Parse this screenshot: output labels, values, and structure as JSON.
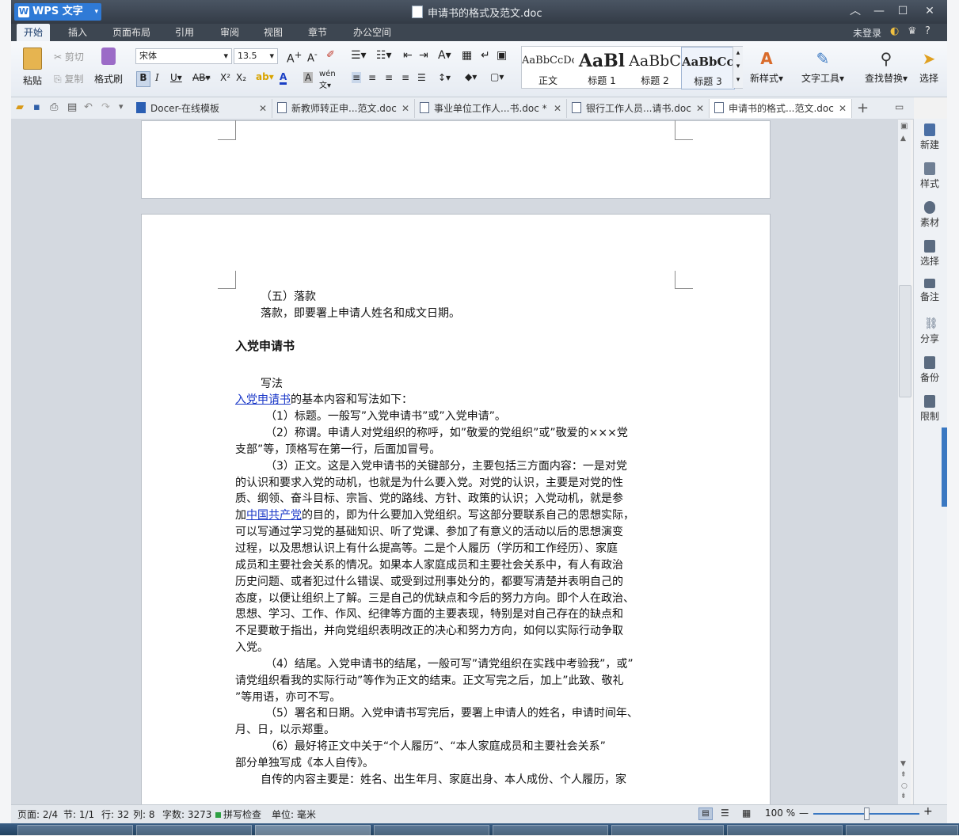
{
  "window": {
    "app_name": "WPS 文字",
    "doc_title": "申请书的格式及范文.doc"
  },
  "menu": {
    "tabs": [
      "开始",
      "插入",
      "页面布局",
      "引用",
      "审阅",
      "视图",
      "章节",
      "办公空间"
    ],
    "login": "未登录"
  },
  "ribbon": {
    "paste": "粘贴",
    "cut": "剪切",
    "copy": "复制",
    "format_painter": "格式刷",
    "font_name": "宋体",
    "font_size": "13.5",
    "styles": [
      {
        "preview": "AaBbCcDc",
        "name": "正文"
      },
      {
        "preview": "AaBl",
        "name": "标题 1"
      },
      {
        "preview": "AaBbC",
        "name": "标题 2"
      },
      {
        "preview": "AaBbCcI",
        "name": "标题 3"
      }
    ],
    "new_style": "新样式",
    "text_tools": "文字工具",
    "find_replace": "查找替换",
    "select": "选择"
  },
  "tabs": [
    {
      "label": "Docer-在线模板"
    },
    {
      "label": "新教师转正申...范文.doc"
    },
    {
      "label": "事业单位工作人...书.doc *"
    },
    {
      "label": "银行工作人员...请书.doc"
    },
    {
      "label": "申请书的格式...范文.doc"
    }
  ],
  "sidebar": {
    "items": [
      "新建",
      "样式",
      "素材",
      "选择",
      "备注",
      "分享",
      "备份",
      "限制"
    ]
  },
  "document": {
    "l1": "（五）落款",
    "l2": "落款，即要署上申请人姓名和成文日期。",
    "heading": "入党申请书",
    "l3": "写法",
    "l4_link": "入党申请书",
    "l4_rest": "的基本内容和写法如下：",
    "l5": "（1）标题。一般写”入党申请书”或”入党申请”。",
    "l6": "（2）称谓。申请人对党组织的称呼，如”敬爱的党组织”或”敬爱的×××党",
    "l7": "支部”等，顶格写在第一行，后面加冒号。",
    "l8": "（3）正文。这是入党申请书的关键部分，主要包括三方面内容：一是对党",
    "l9": "的认识和要求入党的动机，也就是为什么要入党。对党的认识，主要是对党的性",
    "l10": "质、纲领、奋斗目标、宗旨、党的路线、方针、政策的认识；入党动机，就是参",
    "l11_pre": "加",
    "l11_link": "中国共产党",
    "l11_rest": "的目的，即为什么要加入党组织。写这部分要联系自己的思想实际，",
    "l12": "可以写通过学习党的基础知识、听了党课、参加了有意义的活动以后的思想演变",
    "l13": "过程，以及思想认识上有什么提高等。二是个人履历（学历和工作经历）、家庭",
    "l14": "成员和主要社会关系的情况。如果本人家庭成员和主要社会关系中，有人有政治",
    "l15": "历史问题、或者犯过什么错误、或受到过刑事处分的，都要写清楚并表明自己的",
    "l16": "态度，以便让组织上了解。三是自己的优缺点和今后的努力方向。即个人在政治、",
    "l17": "思想、学习、工作、作风、纪律等方面的主要表现，特别是对自己存在的缺点和",
    "l18": "不足要敢于指出，并向党组织表明改正的决心和努力方向，如何以实际行动争取",
    "l19": "入党。",
    "l20": "（4）结尾。入党申请书的结尾，一般可写”请党组织在实践中考验我”，或”",
    "l21": "请党组织看我的实际行动”等作为正文的结束。正文写完之后，加上”此致、敬礼",
    "l22": "”等用语，亦可不写。",
    "l23": "（5）署名和日期。入党申请书写完后，要署上申请人的姓名，申请时间年、",
    "l24": "月、日，以示郑重。",
    "l25": "（6）最好将正文中关于“个人履历”、“本人家庭成员和主要社会关系”",
    "l26": "部分单独写成《本人自传》。",
    "l27": "自传的内容主要是：姓名、出生年月、家庭出身、本人成份、个人履历，家"
  },
  "status": {
    "page": "页面: 2/4",
    "section": "节: 1/1",
    "row": "行: 32",
    "col": "列: 8",
    "words": "字数: 3273",
    "spellcheck": "拼写检查",
    "unit": "单位: 毫米",
    "zoom": "100 %",
    "zoom_fraction": 0.5
  }
}
